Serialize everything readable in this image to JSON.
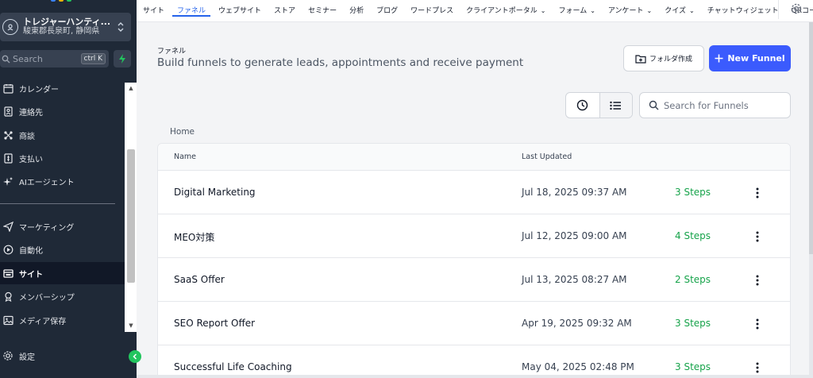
{
  "colors": {
    "sidebar_bg": "#1f2937",
    "accent": "#3b5bfd",
    "active_tab": "#2563eb",
    "steps_green": "#16a34a"
  },
  "sidebar": {
    "account": {
      "name": "トレジャーハンティ...",
      "location": "駿東郡長泉町, 静岡県"
    },
    "search": {
      "label": "Search",
      "shortcut": "ctrl K"
    },
    "items": [
      {
        "label": "カレンダー",
        "icon": "calendar-icon"
      },
      {
        "label": "連絡先",
        "icon": "contacts-icon"
      },
      {
        "label": "商談",
        "icon": "opportunities-icon"
      },
      {
        "label": "支払い",
        "icon": "payments-icon"
      },
      {
        "label": "AIエージェント",
        "icon": "sparkle-icon"
      },
      {
        "label": "マーケティング",
        "icon": "send-icon"
      },
      {
        "label": "自動化",
        "icon": "automation-icon"
      },
      {
        "label": "サイト",
        "icon": "sites-icon"
      },
      {
        "label": "メンバーシップ",
        "icon": "membership-icon"
      },
      {
        "label": "メディア保存",
        "icon": "media-icon"
      },
      {
        "label": "設定",
        "icon": "settings-icon"
      }
    ]
  },
  "topnav": {
    "tabs": [
      {
        "label": "サイト"
      },
      {
        "label": "ファネル"
      },
      {
        "label": "ウェブサイト"
      },
      {
        "label": "ストア"
      },
      {
        "label": "セミナー"
      },
      {
        "label": "分析"
      },
      {
        "label": "ブログ"
      },
      {
        "label": "ワードプレス"
      },
      {
        "label": "クライアントポータル",
        "dropdown": true
      },
      {
        "label": "フォーム",
        "dropdown": true
      },
      {
        "label": "アンケート",
        "dropdown": true
      },
      {
        "label": "クイズ",
        "dropdown": true
      },
      {
        "label": "チャットウィジェット"
      },
      {
        "label": "QRコード"
      }
    ],
    "active": "ファネル"
  },
  "page": {
    "title": "ファネル",
    "subtitle": "Build funnels to generate leads, appointments and receive payment",
    "folder_button": "フォルダ作成",
    "new_button": "New Funnel",
    "search_placeholder": "Search for Funnels",
    "breadcrumb": "Home"
  },
  "table": {
    "headers": {
      "name": "Name",
      "last_updated": "Last Updated"
    },
    "rows": [
      {
        "name": "Digital Marketing",
        "updated": "Jul 18, 2025 09:37 AM",
        "steps": "3 Steps"
      },
      {
        "name": "MEO対策",
        "updated": "Jul 12, 2025 09:00 AM",
        "steps": "4 Steps"
      },
      {
        "name": "SaaS Offer",
        "updated": "Jul 13, 2025 08:27 AM",
        "steps": "2 Steps"
      },
      {
        "name": "SEO Report Offer",
        "updated": "Apr 19, 2025 09:32 AM",
        "steps": "3 Steps"
      },
      {
        "name": "Successful Life Coaching",
        "updated": "May 04, 2025 02:48 PM",
        "steps": "3 Steps"
      }
    ]
  }
}
